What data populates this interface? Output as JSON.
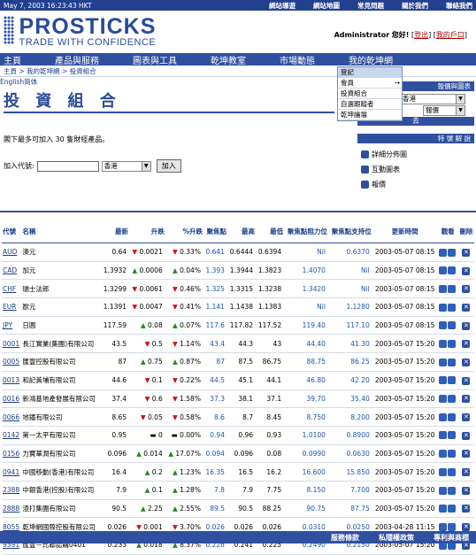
{
  "topbar": {
    "datetime": "May 7, 2003 16:23:43 HKT",
    "links": [
      "網站導遊",
      "網站地圖",
      "常見問題",
      "關於我們",
      "聯絡我們"
    ]
  },
  "logo": {
    "brand": "PROSTICKS",
    "tagline": "TRADE WITH CONFIDENCE"
  },
  "user": {
    "name": "Administrator",
    "greeting": "您好!",
    "logout": "登出",
    "account": "我的戶口"
  },
  "nav": [
    "主頁",
    "產品與服務",
    "圖表與工具",
    "乾坤教室",
    "市場動態",
    "我的乾坤網"
  ],
  "breadcrumb": "主頁 > 我的乾坤網 > 投資組合",
  "lang": {
    "en": "English",
    "sc": "简体"
  },
  "dropdown": [
    "登記",
    "會員",
    "投資組合",
    "自選跟蹤者",
    "乾坤論壇"
  ],
  "page_title": "投 資 組 合",
  "right_panel": {
    "quote_title": "報價與圖表",
    "market": "香港",
    "type": "報價",
    "go_label": "去",
    "tools_title": "特 號 解 說",
    "tools": [
      "詳細分佈圖",
      "互動圖表",
      "報價"
    ]
  },
  "intro": "閣下最多可加入 30 隻財經產品。",
  "add": {
    "label": "加入代號:",
    "market": "香港",
    "button": "加入"
  },
  "columns": [
    "代號",
    "名稱",
    "最新",
    "升跌",
    "%升跌",
    "聚焦點",
    "最高",
    "最低",
    "聚焦點阻力位",
    "聚焦點支持位",
    "更新時間",
    "觀看",
    "刪除"
  ],
  "rows": [
    {
      "code": "AUD",
      "name": "澳元",
      "last": "0.64",
      "chg": "0.0021",
      "pct": "0.33%",
      "dir": "dn",
      "focus": "0.641",
      "high": "0.6444",
      "low": "0.6394",
      "res": "Nil",
      "sup": "0.6370",
      "time": "2003-05-07 08:15"
    },
    {
      "code": "CAD",
      "name": "加元",
      "last": "1.3932",
      "chg": "0.0006",
      "pct": "0.04%",
      "dir": "up",
      "focus": "1.393",
      "high": "1.3944",
      "low": "1.3823",
      "res": "1.4070",
      "sup": "Nil",
      "time": "2003-05-07 08:15"
    },
    {
      "code": "CHF",
      "name": "瑞士法郎",
      "last": "1.3299",
      "chg": "0.0061",
      "pct": "0.46%",
      "dir": "dn",
      "focus": "1.325",
      "high": "1.3315",
      "low": "1.3238",
      "res": "1.3420",
      "sup": "Nil",
      "time": "2003-05-07 08:15"
    },
    {
      "code": "EUR",
      "name": "歐元",
      "last": "1.1391",
      "chg": "0.0047",
      "pct": "0.41%",
      "dir": "dn",
      "focus": "1.141",
      "high": "1.1438",
      "low": "1.1383",
      "res": "Nil",
      "sup": "1.1280",
      "time": "2003-05-07 08:15"
    },
    {
      "code": "JPY",
      "name": "日圓",
      "last": "117.59",
      "chg": "0.08",
      "pct": "0.07%",
      "dir": "up",
      "focus": "117.6",
      "high": "117.82",
      "low": "117.52",
      "res": "119.40",
      "sup": "117.10",
      "time": "2003-05-07 08:15"
    },
    {
      "code": "0001",
      "name": "長江實業(集團)有限公司",
      "last": "43.5",
      "chg": "0.5",
      "pct": "1.14%",
      "dir": "dn",
      "focus": "43.4",
      "high": "44.3",
      "low": "43",
      "res": "44.40",
      "sup": "41.30",
      "time": "2003-05-07 15:20"
    },
    {
      "code": "0005",
      "name": "匯豐控股有限公司",
      "last": "87",
      "chg": "0.75",
      "pct": "0.87%",
      "dir": "up",
      "focus": "87",
      "high": "87.5",
      "low": "86.75",
      "res": "88.75",
      "sup": "86.25",
      "time": "2003-05-07 15:20"
    },
    {
      "code": "0013",
      "name": "和記黃埔有限公司",
      "last": "44.6",
      "chg": "0.1",
      "pct": "0.22%",
      "dir": "dn",
      "focus": "44.5",
      "high": "45.1",
      "low": "44.1",
      "res": "46.80",
      "sup": "42.20",
      "time": "2003-05-07 15:20"
    },
    {
      "code": "0016",
      "name": "新鴻基地產發展有限公司",
      "last": "37.4",
      "chg": "0.6",
      "pct": "1.58%",
      "dir": "dn",
      "focus": "37.3",
      "high": "38.1",
      "low": "37.1",
      "res": "39.70",
      "sup": "35.40",
      "time": "2003-05-07 15:20"
    },
    {
      "code": "0066",
      "name": "地鐵有限公司",
      "last": "8.65",
      "chg": "0.05",
      "pct": "0.58%",
      "dir": "dn",
      "focus": "8.6",
      "high": "8.7",
      "low": "8.45",
      "res": "8.750",
      "sup": "8.200",
      "time": "2003-05-07 15:20"
    },
    {
      "code": "0142",
      "name": "第一太平有限公司",
      "last": "0.95",
      "chg": "0",
      "pct": "0.00%",
      "dir": "eq",
      "focus": "0.94",
      "high": "0.96",
      "low": "0.93",
      "res": "1.0100",
      "sup": "0.8900",
      "time": "2003-05-07 15:20"
    },
    {
      "code": "0156",
      "name": "力寶華潤有限公司",
      "last": "0.096",
      "chg": "0.014",
      "pct": "17.07%",
      "dir": "up",
      "focus": "0.094",
      "high": "0.096",
      "low": "0.08",
      "res": "0.0990",
      "sup": "0.0630",
      "time": "2003-05-07 15:20"
    },
    {
      "code": "0941",
      "name": "中國移動(香港)有限公司",
      "last": "16.4",
      "chg": "0.2",
      "pct": "1.23%",
      "dir": "up",
      "focus": "16.35",
      "high": "16.5",
      "low": "16.2",
      "res": "16.600",
      "sup": "15.850",
      "time": "2003-05-07 15:20"
    },
    {
      "code": "2388",
      "name": "中銀香港(控股)有限公司",
      "last": "7.9",
      "chg": "0.1",
      "pct": "1.28%",
      "dir": "up",
      "focus": "7.8",
      "high": "7.9",
      "low": "7.75",
      "res": "8.150",
      "sup": "7.700",
      "time": "2003-05-07 15:20"
    },
    {
      "code": "2888",
      "name": "渣打集團有限公司",
      "last": "90.5",
      "chg": "2.25",
      "pct": "2.55%",
      "dir": "up",
      "focus": "89.5",
      "high": "90.5",
      "low": "88.25",
      "res": "90.75",
      "sup": "87.75",
      "time": "2003-05-07 15:20"
    },
    {
      "code": "8055",
      "name": "乾坤網國際控股有限公司",
      "last": "0.026",
      "chg": "0.001",
      "pct": "3.70%",
      "dir": "dn",
      "focus": "0.026",
      "high": "0.026",
      "low": "0.026",
      "res": "0.0310",
      "sup": "0.0250",
      "time": "2003-04-28 11:15"
    },
    {
      "code": "9391",
      "name": "匯豐－比聯認購0401",
      "last": "0.233",
      "chg": "0.018",
      "pct": "8.37%",
      "dir": "up",
      "focus": "0.228",
      "high": "0.241",
      "low": "0.225",
      "res": "0.2490",
      "sup": "0.2150",
      "time": "2003-05-07 15:20"
    }
  ],
  "footer": [
    "服務條款",
    "私隱權政策",
    "專利與商標"
  ]
}
